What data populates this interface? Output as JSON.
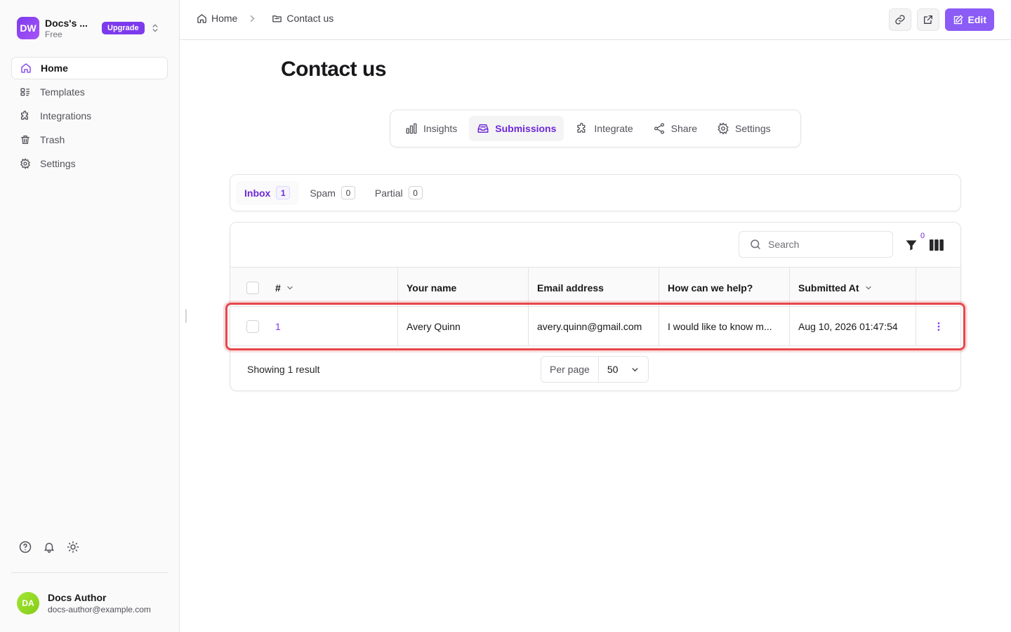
{
  "workspace": {
    "initials": "DW",
    "name": "Docs's ...",
    "plan": "Free",
    "upgrade_label": "Upgrade"
  },
  "sidebar": {
    "items": [
      {
        "label": "Home",
        "icon": "home-icon",
        "active": true
      },
      {
        "label": "Templates",
        "icon": "templates-icon"
      },
      {
        "label": "Integrations",
        "icon": "puzzle-icon"
      },
      {
        "label": "Trash",
        "icon": "trash-icon"
      },
      {
        "label": "Settings",
        "icon": "gear-icon"
      }
    ],
    "tools": [
      "help-icon",
      "bell-icon",
      "sun-icon"
    ]
  },
  "user": {
    "initials": "DA",
    "name": "Docs Author",
    "email": "docs-author@example.com"
  },
  "breadcrumb": {
    "home": "Home",
    "current": "Contact us"
  },
  "header": {
    "edit_label": "Edit"
  },
  "page": {
    "title": "Contact us"
  },
  "form_tabs": [
    {
      "label": "Insights",
      "icon": "bar-chart-icon"
    },
    {
      "label": "Submissions",
      "icon": "inbox-icon",
      "active": true
    },
    {
      "label": "Integrate",
      "icon": "puzzle-icon"
    },
    {
      "label": "Share",
      "icon": "share-icon"
    },
    {
      "label": "Settings",
      "icon": "gear-icon"
    }
  ],
  "sub_tabs": [
    {
      "label": "Inbox",
      "count": "1",
      "active": true
    },
    {
      "label": "Spam",
      "count": "0"
    },
    {
      "label": "Partial",
      "count": "0"
    }
  ],
  "table": {
    "search_placeholder": "Search",
    "filter_count": "0",
    "headers": [
      "#",
      "Your name",
      "Email address",
      "How can we help?",
      "Submitted At"
    ],
    "rows": [
      {
        "num": "1",
        "name": "Avery Quinn",
        "email": "avery.quinn@gmail.com",
        "help": "I would like to know m...",
        "submitted": "Aug 10, 2026 01:47:54"
      }
    ],
    "result_text": "Showing 1 result",
    "per_page_label": "Per page",
    "per_page_value": "50"
  },
  "colors": {
    "accent": "#7c3aed",
    "highlight": "#e5484d"
  }
}
